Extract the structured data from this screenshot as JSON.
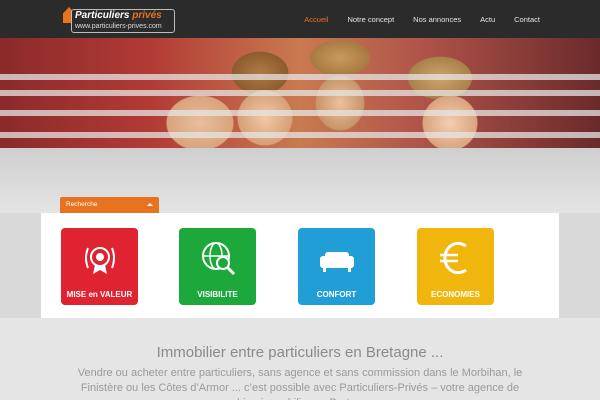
{
  "header": {
    "logo": {
      "title_main": "Particuliers ",
      "title_accent": "privés",
      "url": "www.particuliers-prives.com"
    },
    "nav": [
      "Accueil",
      "Notre concept",
      "Nos annonces",
      "Actu",
      "Contact"
    ],
    "nav_active": "Accueil"
  },
  "search": {
    "label": "Recherche"
  },
  "features": [
    {
      "label": "MISE en VALEUR",
      "icon": "medal-icon",
      "color": "#e02330"
    },
    {
      "label": "VISIBILITE",
      "icon": "globe-search-icon",
      "color": "#1ca83a"
    },
    {
      "label": "CONFORT",
      "icon": "sofa-icon",
      "color": "#219ed6"
    },
    {
      "label": "ECONOMIES",
      "icon": "euro-icon",
      "color": "#f1b60d"
    }
  ],
  "intro": {
    "title": "Immobilier entre particuliers en Bretagne ...",
    "body": "Vendre ou acheter entre particuliers, sans agence et sans commission dans le Morbihan, le Finistère ou les Côtes d’Armor ... c’est possible avec Particuliers-Privés –  votre agence de coaching immobilier en Bretagne ..."
  },
  "colors": {
    "accent": "#e8731f",
    "header_bg": "#2b2b2b"
  }
}
